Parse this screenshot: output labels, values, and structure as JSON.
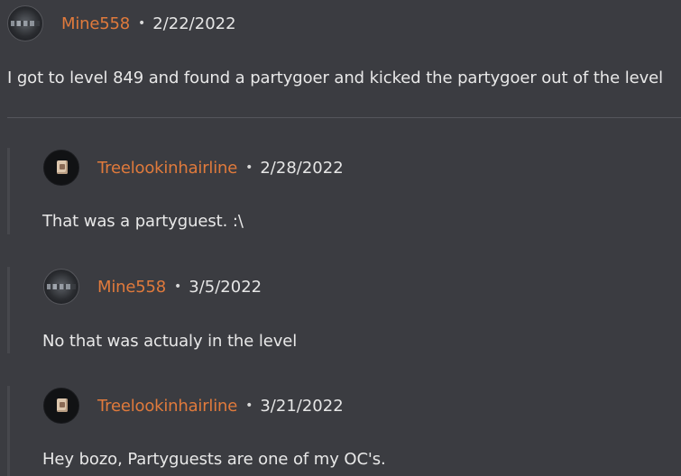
{
  "comments": [
    {
      "avatar": "dark-city-avatar",
      "username": "Mine558",
      "separator": "•",
      "date": "2/22/2022",
      "text": "I got to level 849 and found a partygoer and kicked the partygoer out of the level"
    },
    {
      "avatar": "scroll-avatar",
      "username": "Treelookinhairline",
      "separator": "•",
      "date": "2/28/2022",
      "text": "That was a partyguest. :\\"
    },
    {
      "avatar": "dark-city-avatar",
      "username": "Mine558",
      "separator": "•",
      "date": "3/5/2022",
      "text": "No that was actualy in the level"
    },
    {
      "avatar": "scroll-avatar",
      "username": "Treelookinhairline",
      "separator": "•",
      "date": "3/21/2022",
      "text": "Hey bozo, Partyguests are one of my OC's."
    }
  ],
  "colors": {
    "background": "#3b3c41",
    "username": "#e07a3c",
    "text": "#e6e6e6",
    "divider": "#55565c",
    "thread_line": "#47484d"
  }
}
